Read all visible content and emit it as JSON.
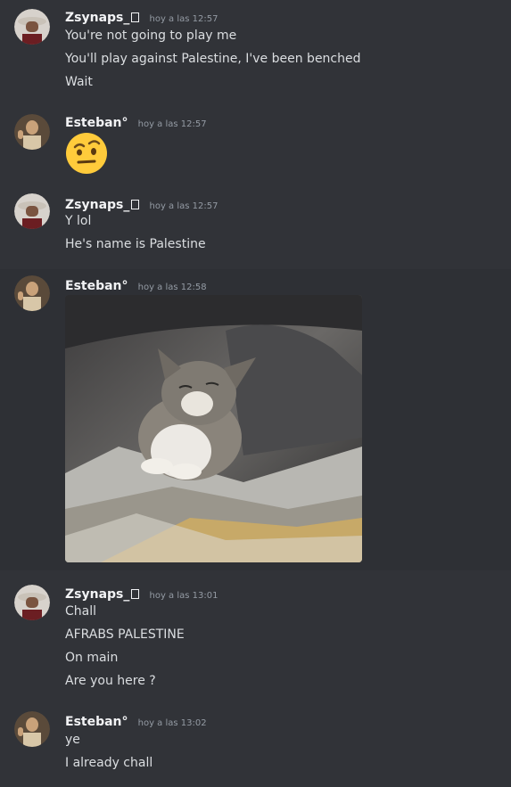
{
  "messages": [
    {
      "user": "Zsynaps_",
      "time": "hoy a las 12:57",
      "lines": [
        "You're not going to play me",
        "You'll play against Palestine, I've been benched",
        "Wait"
      ]
    },
    {
      "user": "Esteban°",
      "time": "hoy a las 12:57",
      "emoji": "face-with-raised-eyebrow"
    },
    {
      "user": "Zsynaps_",
      "time": "hoy a las 12:57",
      "lines": [
        "Y lol",
        "He's name is Palestine"
      ]
    },
    {
      "user": "Esteban°",
      "time": "hoy a las 12:58",
      "attachment": "kitten-gif"
    },
    {
      "user": "Zsynaps_",
      "time": "hoy a las 13:01",
      "lines": [
        "Chall",
        "AFRABS PALESTINE",
        "On main",
        "Are you here ?"
      ]
    },
    {
      "user": "Esteban°",
      "time": "hoy a las 13:02",
      "lines": [
        "ye",
        "I already chall"
      ]
    }
  ],
  "colors": {
    "background": "#313338",
    "username": "#f2f3f5",
    "timestamp": "#949ba4",
    "text": "#dbdee1",
    "hover_background": "#2e3035"
  }
}
